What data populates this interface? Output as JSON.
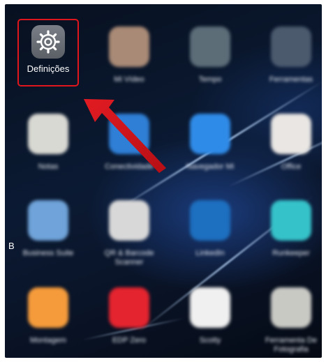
{
  "apps": [
    {
      "label": "Definições",
      "icon": "gear-icon",
      "color": "#6b6f76",
      "highlighted": true
    },
    {
      "label": "Mi Vídeo",
      "icon": "play-icon",
      "color": "#a98a76"
    },
    {
      "label": "Tempo",
      "icon": "cloud-icon",
      "color": "#5c6d78"
    },
    {
      "label": "Ferramentas",
      "icon": "tools-icon",
      "color": "#4c5a6e"
    },
    {
      "label": "Notas",
      "icon": "note-icon",
      "color": "#d9d9d3"
    },
    {
      "label": "Conectividade",
      "icon": "link-icon",
      "color": "#2f7fd6"
    },
    {
      "label": "Navegador Mi",
      "icon": "browser-icon",
      "color": "#2f8be8"
    },
    {
      "label": "Office",
      "icon": "office-icon",
      "color": "#e9e6e3"
    },
    {
      "label": "Business Suite",
      "icon": "business-icon",
      "color": "#6fa3d9"
    },
    {
      "label": "QR & Barcode Scanner",
      "icon": "qr-icon",
      "color": "#d8d8d8"
    },
    {
      "label": "LinkedIn",
      "icon": "linkedin-icon",
      "color": "#1d6fbf"
    },
    {
      "label": "Runkeeper",
      "icon": "runner-icon",
      "color": "#35c2c9"
    },
    {
      "label": "Montagem",
      "icon": "image-icon",
      "color": "#f59b3b"
    },
    {
      "label": "EDP Zero",
      "icon": "ring-icon",
      "color": "#e4242f"
    },
    {
      "label": "Scotty",
      "icon": "scotty-icon",
      "color": "#f0f0f0"
    },
    {
      "label": "Ferramenta De Fotografia",
      "icon": "aperture-icon",
      "color": "#c9c9c4"
    }
  ],
  "stray_text": "B",
  "colors": {
    "highlight": "#e0161c",
    "arrow": "#d4141b"
  }
}
